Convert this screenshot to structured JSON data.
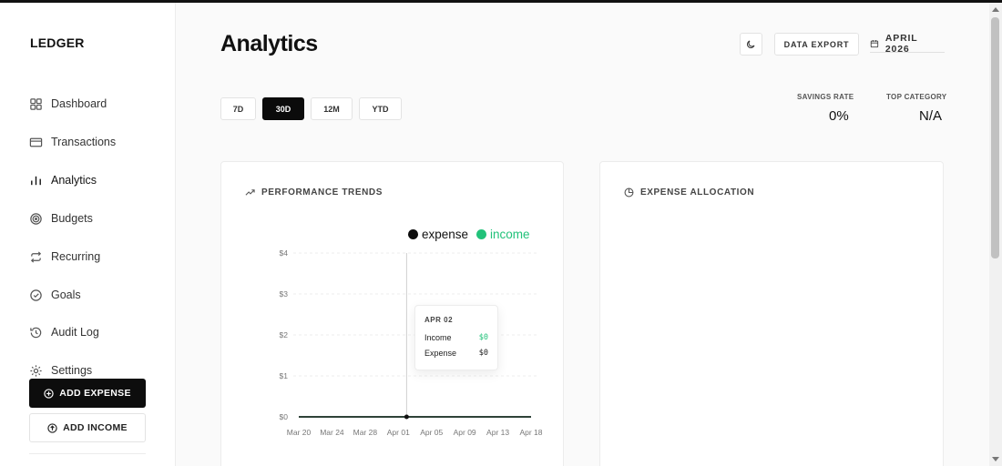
{
  "brand": "LEDGER",
  "nav": [
    {
      "label": "Dashboard",
      "icon": "dashboard-icon"
    },
    {
      "label": "Transactions",
      "icon": "card-icon"
    },
    {
      "label": "Analytics",
      "icon": "bar-chart-icon"
    },
    {
      "label": "Budgets",
      "icon": "target-icon"
    },
    {
      "label": "Recurring",
      "icon": "repeat-icon"
    },
    {
      "label": "Goals",
      "icon": "check-circle-icon"
    },
    {
      "label": "Audit Log",
      "icon": "history-icon"
    },
    {
      "label": "Settings",
      "icon": "gear-icon"
    }
  ],
  "actions": {
    "add_expense": "ADD EXPENSE",
    "add_income": "ADD INCOME"
  },
  "header": {
    "title": "Analytics",
    "export_label": "DATA EXPORT",
    "date_label": "APRIL 2026"
  },
  "ranges": [
    {
      "label": "7D",
      "active": false
    },
    {
      "label": "30D",
      "active": true
    },
    {
      "label": "12M",
      "active": false
    },
    {
      "label": "YTD",
      "active": false
    }
  ],
  "stats": {
    "savings_rate_label": "SAVINGS RATE",
    "savings_rate_value": "0%",
    "top_category_label": "TOP CATEGORY",
    "top_category_value": "N/A"
  },
  "performance": {
    "title": "PERFORMANCE TRENDS"
  },
  "allocation": {
    "title": "EXPENSE ALLOCATION"
  },
  "legend": {
    "expense": "expense",
    "income": "income"
  },
  "tooltip": {
    "date": "APR 02",
    "income_label": "Income",
    "income_value": "$0",
    "expense_label": "Expense",
    "expense_value": "$0"
  },
  "colors": {
    "expense": "#0d0d0d",
    "income": "#22c27a",
    "accent": "#0b0b0b"
  },
  "chart_data": {
    "type": "line",
    "x": [
      "Mar 20",
      "Mar 24",
      "Mar 28",
      "Apr 01",
      "Apr 05",
      "Apr 09",
      "Apr 13",
      "Apr 18"
    ],
    "series": [
      {
        "name": "expense",
        "values": [
          0,
          0,
          0,
          0,
          0,
          0,
          0,
          0
        ]
      },
      {
        "name": "income",
        "values": [
          0,
          0,
          0,
          0,
          0,
          0,
          0,
          0
        ]
      }
    ],
    "yticks": [
      "$0",
      "$1",
      "$2",
      "$3",
      "$4"
    ],
    "ylim": [
      0,
      4
    ],
    "grid": true,
    "legend_position": "top-right",
    "highlight": {
      "x": "Apr 02",
      "income": 0,
      "expense": 0
    }
  }
}
